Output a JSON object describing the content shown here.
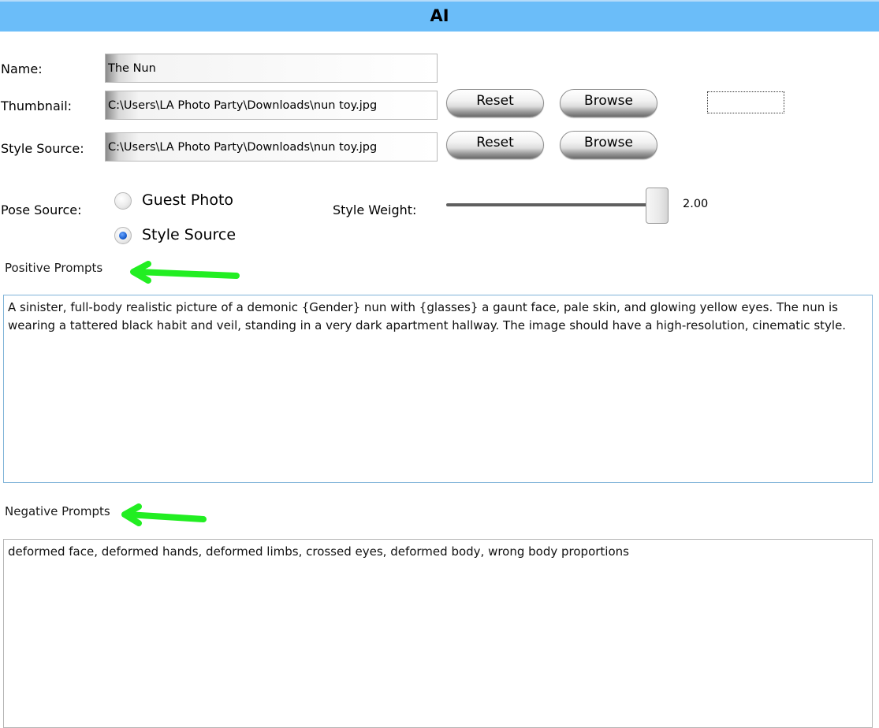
{
  "window": {
    "title": "AI"
  },
  "form": {
    "name_label": "Name:",
    "name_value": "The Nun",
    "thumbnail_label": "Thumbnail:",
    "thumbnail_value": "C:\\Users\\LA Photo Party\\Downloads\\nun toy.jpg",
    "style_source_label": "Style Source:",
    "style_source_value": "C:\\Users\\LA Photo Party\\Downloads\\nun toy.jpg",
    "reset_label": "Reset",
    "browse_label": "Browse"
  },
  "pose": {
    "label": "Pose Source:",
    "options": [
      "Guest Photo",
      "Style Source"
    ],
    "selected": "Style Source"
  },
  "style_weight": {
    "label": "Style Weight:",
    "value_text": "2.00",
    "slider_fraction": 0.95
  },
  "prompts": {
    "positive_label": "Positive Prompts",
    "positive_text": "A sinister, full-body realistic picture of a demonic {Gender} nun with {glasses} a gaunt face, pale skin, and glowing yellow eyes. The nun is wearing a tattered black habit and veil, standing in a very dark apartment hallway. The image should have a high-resolution, cinematic style.",
    "negative_label": "Negative Prompts",
    "negative_text": "deformed face, deformed hands, deformed limbs, crossed eyes, deformed body, wrong body proportions"
  },
  "annotations": {
    "arrow_color": "#22ee22"
  }
}
